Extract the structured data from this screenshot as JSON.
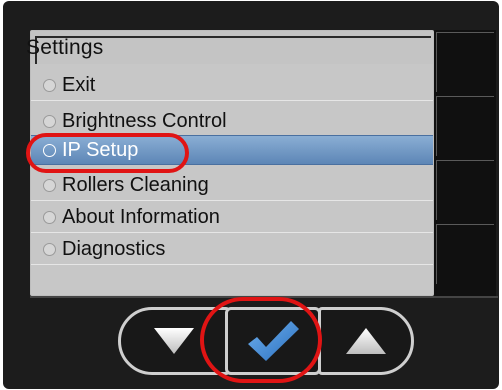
{
  "screen": {
    "title": "Settings",
    "menu_items": [
      {
        "label": "Exit",
        "selected": false
      },
      {
        "label": "Brightness Control",
        "selected": false
      },
      {
        "label": "IP Setup",
        "selected": true
      },
      {
        "label": "Rollers Cleaning",
        "selected": false
      },
      {
        "label": "About Information",
        "selected": false
      },
      {
        "label": "Diagnostics",
        "selected": false
      }
    ]
  },
  "buttons": {
    "down": {
      "icon": "triangle-down-icon",
      "color": "#f2f2f2"
    },
    "ok": {
      "icon": "checkmark-icon",
      "color": "#3c82d0"
    },
    "up": {
      "icon": "triangle-up-icon",
      "color": "#f2f2f2"
    }
  },
  "colors": {
    "selection": "#6f95c2",
    "annotation": "#e01414",
    "bezel": "#1c1c1c",
    "screen_bg": "#c7c7c7"
  }
}
